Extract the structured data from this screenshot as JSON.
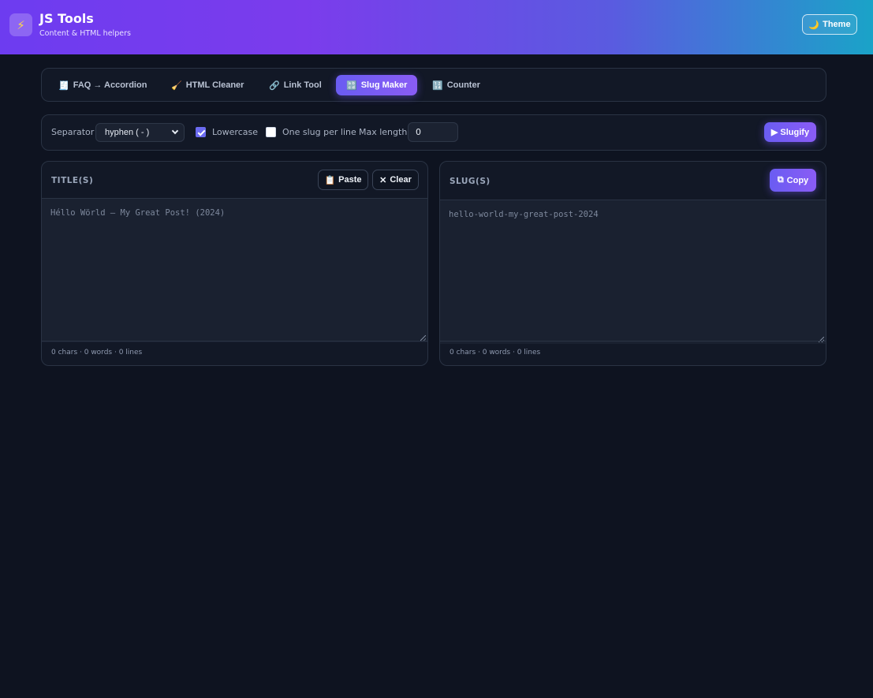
{
  "header": {
    "logo_icon": "⚡",
    "title": "JS Tools",
    "subtitle": "Content & HTML helpers",
    "theme_icon": "🌙",
    "theme_label": "Theme"
  },
  "tabs": [
    {
      "icon": "🧾",
      "label": "FAQ → Accordion",
      "active": false
    },
    {
      "icon": "🧹",
      "label": "HTML Cleaner",
      "active": false
    },
    {
      "icon": "🔗",
      "label": "Link Tool",
      "active": false
    },
    {
      "icon": "🔡",
      "label": "Slug Maker",
      "active": true
    },
    {
      "icon": "🔢",
      "label": "Counter",
      "active": false
    }
  ],
  "options": {
    "separator_label": "Separator",
    "separator_value": "hyphen ( - )",
    "lowercase_label": "Lowercase",
    "lowercase_checked": true,
    "one_per_line_label": "One slug per line",
    "one_per_line_checked": false,
    "max_length_label": "Max length",
    "max_length_value": "0",
    "slugify_icon": "▶",
    "slugify_label": "Slugify"
  },
  "input_panel": {
    "title": "TITLE(S)",
    "paste_icon": "📋",
    "paste_label": "Paste",
    "clear_icon": "✕",
    "clear_label": "Clear",
    "placeholder": "Héllo Wörld — My Great Post! (2024)",
    "stats": "0 chars · 0 words · 0 lines"
  },
  "output_panel": {
    "title": "SLUG(S)",
    "copy_icon": "⧉",
    "copy_label": "Copy",
    "placeholder": "hello-world-my-great-post-2024",
    "stats": "0 chars · 0 words · 0 lines"
  },
  "colors": {
    "background": "#0e1320",
    "accent": "#6a5cf2",
    "header_gradient_start": "#6d3cf0",
    "header_gradient_end": "#1aa3c8"
  }
}
